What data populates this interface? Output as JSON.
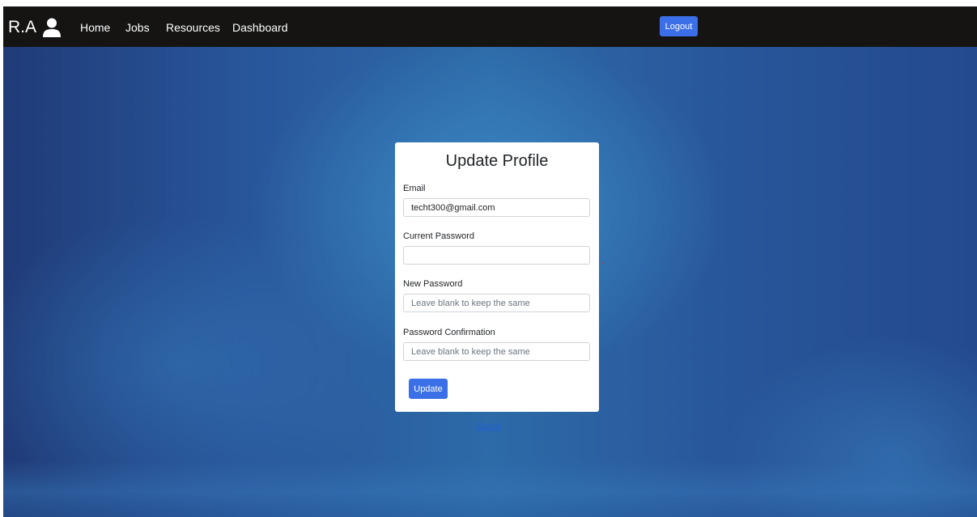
{
  "navbar": {
    "brand": "R.A",
    "links": [
      "Home",
      "Jobs",
      "Resources",
      "Dashboard"
    ],
    "logout_label": "Logout"
  },
  "form": {
    "title": "Update Profile",
    "email": {
      "label": "Email",
      "value": "techt300@gmail.com"
    },
    "current_password": {
      "label": "Current Password",
      "value": ""
    },
    "new_password": {
      "label": "New Password",
      "placeholder": "Leave blank to keep the same"
    },
    "password_confirmation": {
      "label": "Password Confirmation",
      "placeholder": "Leave blank to keep the same"
    },
    "submit_label": "Update"
  },
  "cancel_label": "Cancel",
  "colors": {
    "navbar": "#151413",
    "primary_button": "#3b6fe8",
    "background": "#2d6aa8"
  }
}
